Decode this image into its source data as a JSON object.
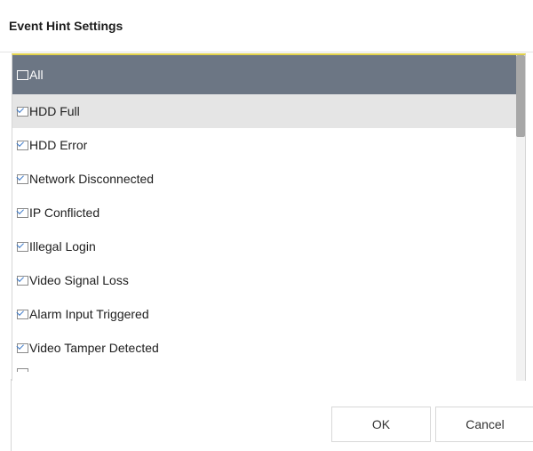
{
  "dialog": {
    "title": "Event Hint Settings",
    "items": [
      {
        "label": "All",
        "checked": false,
        "style": "header"
      },
      {
        "label": "HDD Full",
        "checked": true,
        "style": "highlight"
      },
      {
        "label": "HDD Error",
        "checked": true,
        "style": "normal"
      },
      {
        "label": "Network Disconnected",
        "checked": true,
        "style": "normal"
      },
      {
        "label": "IP Conflicted",
        "checked": true,
        "style": "normal"
      },
      {
        "label": "Illegal Login",
        "checked": true,
        "style": "normal"
      },
      {
        "label": "Video Signal Loss",
        "checked": true,
        "style": "normal"
      },
      {
        "label": "Alarm Input Triggered",
        "checked": true,
        "style": "normal"
      },
      {
        "label": "Video Tamper Detected",
        "checked": true,
        "style": "normal"
      }
    ],
    "ok_label": "OK",
    "cancel_label": "Cancel"
  },
  "colors": {
    "header_bg": "#6c7684",
    "highlight_bg": "#e5e5e5",
    "focus_border": "#e2d24c",
    "check_color": "#3a78c8"
  },
  "icons": {
    "checkbox": "checkbox-icon"
  }
}
